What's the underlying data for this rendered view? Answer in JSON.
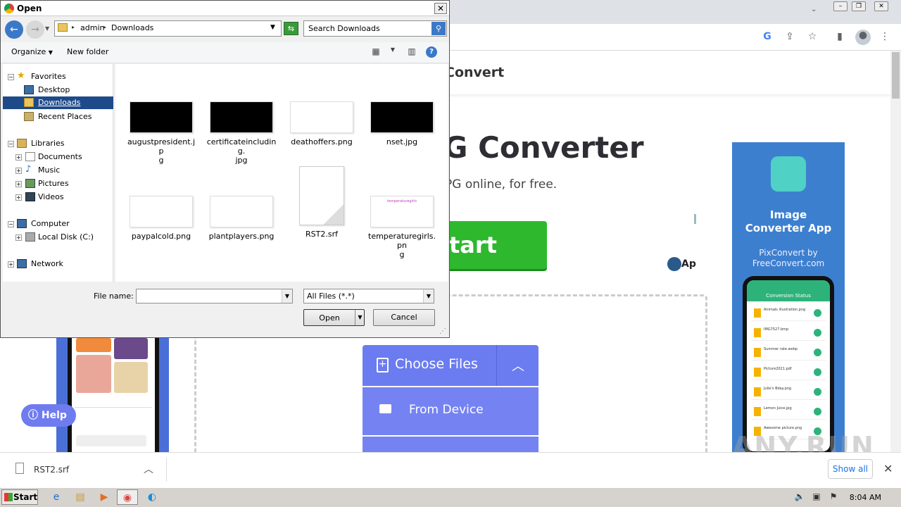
{
  "dialog": {
    "title": "Open",
    "close_glyph": "✕",
    "address": {
      "segments": [
        "admin",
        "Downloads"
      ]
    },
    "search_placeholder": "Search Downloads",
    "toolbar": {
      "organize": "Organize",
      "new_folder": "New folder"
    },
    "nav": {
      "favorites": "Favorites",
      "desktop": "Desktop",
      "downloads": "Downloads",
      "recent_places": "Recent Places",
      "libraries": "Libraries",
      "documents": "Documents",
      "music": "Music",
      "pictures": "Pictures",
      "videos": "Videos",
      "computer": "Computer",
      "local_disk": "Local Disk (C:)",
      "network": "Network"
    },
    "files": [
      {
        "name": "augustpresident.jpg",
        "display": "augustpresident.jp\ng",
        "thumb": "dark"
      },
      {
        "name": "certificateincluding.jpg",
        "display": "certificateincluding.\njpg",
        "thumb": "dark"
      },
      {
        "name": "deathoffers.png",
        "display": "deathoffers.png",
        "thumb": "light"
      },
      {
        "name": "nset.jpg",
        "display": "nset.jpg",
        "thumb": "dark"
      },
      {
        "name": "paypalcold.png",
        "display": "paypalcold.png",
        "thumb": "light"
      },
      {
        "name": "plantplayers.png",
        "display": "plantplayers.png",
        "thumb": "light"
      },
      {
        "name": "RST2.srf",
        "display": "RST2.srf",
        "thumb": "doc"
      },
      {
        "name": "temperaturegirls.png",
        "display": "temperaturegirls.pn\ng",
        "thumb": "light",
        "thumb_text": "temperaturegirls"
      }
    ],
    "file_name_label": "File name:",
    "file_name_value": "",
    "filter_value": "All Files (*.*)",
    "open_label": "Open",
    "cancel_label": "Cancel"
  },
  "page": {
    "brand": "Convert",
    "hero_title": "G Converter",
    "hero_sub": "PG online, for free.",
    "start_label": "tart",
    "ap_logo": "Ap",
    "ad": {
      "title": "Image\nConverter App",
      "by": "PixConvert by\nFreeConvert.com",
      "phone_header": "Conversion Status",
      "phone_rows": [
        "Animals illustration.png",
        "IMG7527.bmp",
        "Summer rate.webp",
        "Picture2021.pdf",
        "Julie's Bday.png",
        "Lemon Juice.jpg",
        "Awesome picture.png"
      ]
    },
    "help_label": "Help",
    "choose_files": "Choose Files",
    "from_device": "From Device",
    "watermark": "ANY.RUN"
  },
  "downloads_bar": {
    "file": "RST2.srf",
    "show_all": "Show all"
  },
  "taskbar": {
    "start": "Start",
    "clock": "8:04 AM"
  },
  "colors": {
    "accent_green": "#2eb82e",
    "choose_blue": "#6b7cf0",
    "ad_blue": "#3d7fcf",
    "selection": "#1e4a8a"
  }
}
